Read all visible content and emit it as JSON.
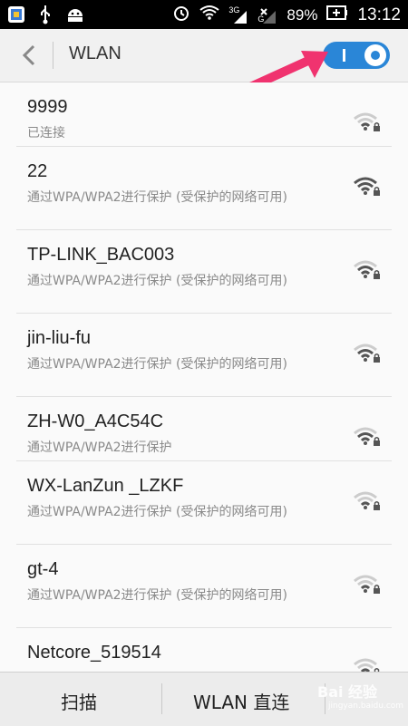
{
  "status_bar": {
    "network_type": "3G",
    "network_sub": "G",
    "battery_percent": "89%",
    "time": "13:12",
    "icons": [
      "app-icon",
      "usb-icon",
      "android-icon",
      "alarm-icon",
      "wifi-status-icon",
      "signal-icon",
      "no-signal-icon",
      "battery-icon"
    ]
  },
  "header": {
    "title": "WLAN",
    "wlan_enabled": true,
    "accent_color": "#2a86d7",
    "arrow_color": "#f0336f"
  },
  "networks": [
    {
      "ssid": "9999",
      "status": "已连接",
      "signal": "weak",
      "secured": true
    },
    {
      "ssid": "22",
      "status": "通过WPA/WPA2进行保护 (受保护的网络可用)",
      "signal": "strong",
      "secured": true
    },
    {
      "ssid": "TP-LINK_BAC003",
      "status": "通过WPA/WPA2进行保护 (受保护的网络可用)",
      "signal": "medium",
      "secured": true
    },
    {
      "ssid": "jin-liu-fu",
      "status": "通过WPA/WPA2进行保护 (受保护的网络可用)",
      "signal": "medium",
      "secured": true
    },
    {
      "ssid": "ZH-W0_A4C54C",
      "status": "通过WPA/WPA2进行保护",
      "signal": "medium",
      "secured": true
    },
    {
      "ssid": "WX-LanZun _LZKF",
      "status": "通过WPA/WPA2进行保护 (受保护的网络可用)",
      "signal": "weak",
      "secured": true
    },
    {
      "ssid": "gt-4",
      "status": "通过WPA/WPA2进行保护 (受保护的网络可用)",
      "signal": "weak",
      "secured": true
    },
    {
      "ssid": "Netcore_519514",
      "status": "",
      "signal": "weak",
      "secured": true
    }
  ],
  "bottom_bar": {
    "scan_label": "扫描",
    "direct_label": "WLAN 直连",
    "watermark": "Bai 经验",
    "watermark_url": "jingyan.baidu.com"
  }
}
